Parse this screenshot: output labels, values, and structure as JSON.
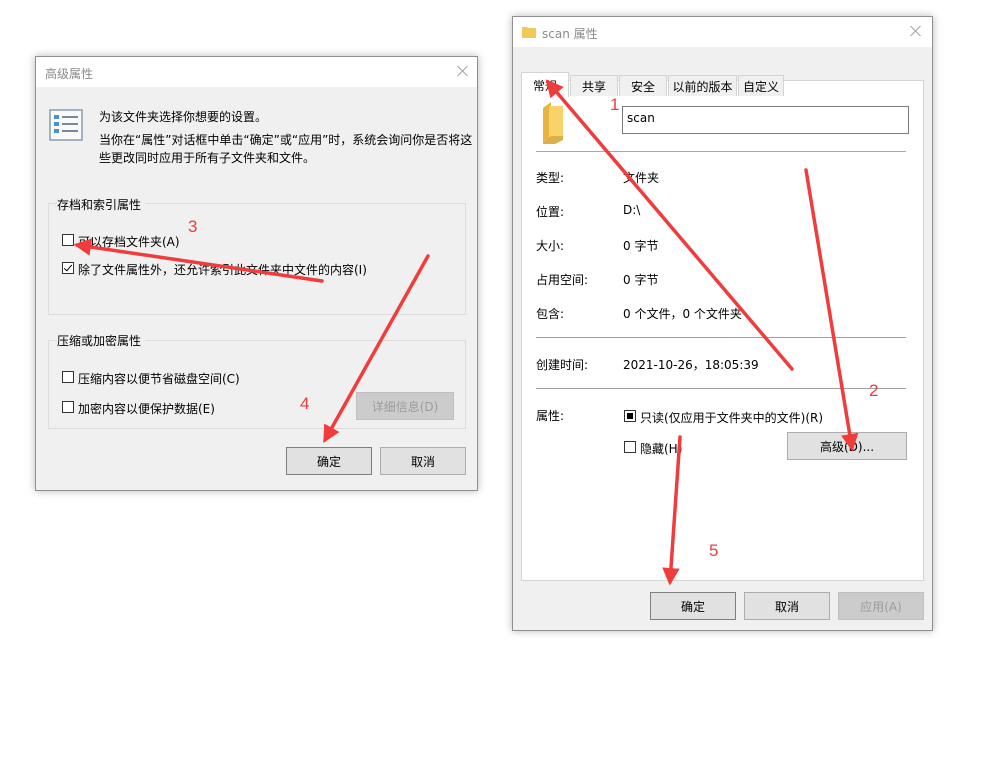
{
  "advanced_dialog": {
    "title": "高级属性",
    "intro_line1": "为该文件夹选择你想要的设置。",
    "intro_line2": "当你在“属性”对话框中单击“确定”或“应用”时，系统会询问你是否将这",
    "intro_line3": "些更改同时应用于所有子文件夹和文件。",
    "archive_group_title": "存档和索引属性",
    "archive_checkbox_label": "可以存档文件夹(A)",
    "archive_checkbox_checked": false,
    "index_checkbox_label": "除了文件属性外，还允许索引此文件夹中文件的内容(I)",
    "index_checkbox_checked": true,
    "compress_group_title": "压缩或加密属性",
    "compress_checkbox_label": "压缩内容以便节省磁盘空间(C)",
    "compress_checkbox_checked": false,
    "encrypt_checkbox_label": "加密内容以便保护数据(E)",
    "encrypt_checkbox_checked": false,
    "details_button": "详细信息(D)",
    "ok_button": "确定",
    "cancel_button": "取消"
  },
  "properties_dialog": {
    "title": "scan 属性",
    "tabs": [
      {
        "label": "常规",
        "active": true
      },
      {
        "label": "共享",
        "active": false
      },
      {
        "label": "安全",
        "active": false
      },
      {
        "label": "以前的版本",
        "active": false
      },
      {
        "label": "自定义",
        "active": false
      }
    ],
    "folder_name": "scan",
    "rows": [
      {
        "label": "类型:",
        "value": "文件夹"
      },
      {
        "label": "位置:",
        "value": "D:\\"
      },
      {
        "label": "大小:",
        "value": "0 字节"
      },
      {
        "label": "占用空间:",
        "value": "0 字节"
      },
      {
        "label": "包含:",
        "value": "0 个文件，0 个文件夹"
      }
    ],
    "created_label": "创建时间:",
    "created_value": "2021-10-26，18:05:39",
    "attributes_label": "属性:",
    "readonly_label": "只读(仅应用于文件夹中的文件)(R)",
    "hidden_label": "隐藏(H)",
    "advanced_button": "高级(D)...",
    "ok_button": "确定",
    "cancel_button": "取消",
    "apply_button": "应用(A)"
  },
  "annotations": [
    "1",
    "2",
    "3",
    "4",
    "5"
  ],
  "colors": {
    "annotation": "#f03c3c",
    "dialog_bg": "#f0f0f0",
    "folder_icon": "#f3c85a"
  },
  "icons": {
    "folder": "folder-icon",
    "settings_list": "checklist-icon",
    "close": "close-icon"
  }
}
